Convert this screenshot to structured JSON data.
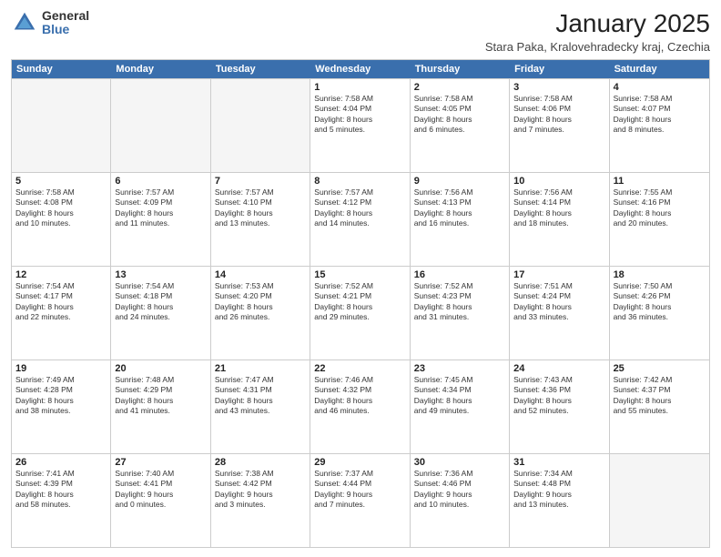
{
  "logo": {
    "general": "General",
    "blue": "Blue"
  },
  "title": "January 2025",
  "location": "Stara Paka, Kralovehradecky kraj, Czechia",
  "header": {
    "days": [
      "Sunday",
      "Monday",
      "Tuesday",
      "Wednesday",
      "Thursday",
      "Friday",
      "Saturday"
    ]
  },
  "weeks": [
    [
      {
        "day": "",
        "empty": true,
        "content": ""
      },
      {
        "day": "",
        "empty": true,
        "content": ""
      },
      {
        "day": "",
        "empty": true,
        "content": ""
      },
      {
        "day": "1",
        "content": "Sunrise: 7:58 AM\nSunset: 4:04 PM\nDaylight: 8 hours\nand 5 minutes."
      },
      {
        "day": "2",
        "content": "Sunrise: 7:58 AM\nSunset: 4:05 PM\nDaylight: 8 hours\nand 6 minutes."
      },
      {
        "day": "3",
        "content": "Sunrise: 7:58 AM\nSunset: 4:06 PM\nDaylight: 8 hours\nand 7 minutes."
      },
      {
        "day": "4",
        "content": "Sunrise: 7:58 AM\nSunset: 4:07 PM\nDaylight: 8 hours\nand 8 minutes."
      }
    ],
    [
      {
        "day": "5",
        "content": "Sunrise: 7:58 AM\nSunset: 4:08 PM\nDaylight: 8 hours\nand 10 minutes."
      },
      {
        "day": "6",
        "content": "Sunrise: 7:57 AM\nSunset: 4:09 PM\nDaylight: 8 hours\nand 11 minutes."
      },
      {
        "day": "7",
        "content": "Sunrise: 7:57 AM\nSunset: 4:10 PM\nDaylight: 8 hours\nand 13 minutes."
      },
      {
        "day": "8",
        "content": "Sunrise: 7:57 AM\nSunset: 4:12 PM\nDaylight: 8 hours\nand 14 minutes."
      },
      {
        "day": "9",
        "content": "Sunrise: 7:56 AM\nSunset: 4:13 PM\nDaylight: 8 hours\nand 16 minutes."
      },
      {
        "day": "10",
        "content": "Sunrise: 7:56 AM\nSunset: 4:14 PM\nDaylight: 8 hours\nand 18 minutes."
      },
      {
        "day": "11",
        "content": "Sunrise: 7:55 AM\nSunset: 4:16 PM\nDaylight: 8 hours\nand 20 minutes."
      }
    ],
    [
      {
        "day": "12",
        "content": "Sunrise: 7:54 AM\nSunset: 4:17 PM\nDaylight: 8 hours\nand 22 minutes."
      },
      {
        "day": "13",
        "content": "Sunrise: 7:54 AM\nSunset: 4:18 PM\nDaylight: 8 hours\nand 24 minutes."
      },
      {
        "day": "14",
        "content": "Sunrise: 7:53 AM\nSunset: 4:20 PM\nDaylight: 8 hours\nand 26 minutes."
      },
      {
        "day": "15",
        "content": "Sunrise: 7:52 AM\nSunset: 4:21 PM\nDaylight: 8 hours\nand 29 minutes."
      },
      {
        "day": "16",
        "content": "Sunrise: 7:52 AM\nSunset: 4:23 PM\nDaylight: 8 hours\nand 31 minutes."
      },
      {
        "day": "17",
        "content": "Sunrise: 7:51 AM\nSunset: 4:24 PM\nDaylight: 8 hours\nand 33 minutes."
      },
      {
        "day": "18",
        "content": "Sunrise: 7:50 AM\nSunset: 4:26 PM\nDaylight: 8 hours\nand 36 minutes."
      }
    ],
    [
      {
        "day": "19",
        "content": "Sunrise: 7:49 AM\nSunset: 4:28 PM\nDaylight: 8 hours\nand 38 minutes."
      },
      {
        "day": "20",
        "content": "Sunrise: 7:48 AM\nSunset: 4:29 PM\nDaylight: 8 hours\nand 41 minutes."
      },
      {
        "day": "21",
        "content": "Sunrise: 7:47 AM\nSunset: 4:31 PM\nDaylight: 8 hours\nand 43 minutes."
      },
      {
        "day": "22",
        "content": "Sunrise: 7:46 AM\nSunset: 4:32 PM\nDaylight: 8 hours\nand 46 minutes."
      },
      {
        "day": "23",
        "content": "Sunrise: 7:45 AM\nSunset: 4:34 PM\nDaylight: 8 hours\nand 49 minutes."
      },
      {
        "day": "24",
        "content": "Sunrise: 7:43 AM\nSunset: 4:36 PM\nDaylight: 8 hours\nand 52 minutes."
      },
      {
        "day": "25",
        "content": "Sunrise: 7:42 AM\nSunset: 4:37 PM\nDaylight: 8 hours\nand 55 minutes."
      }
    ],
    [
      {
        "day": "26",
        "content": "Sunrise: 7:41 AM\nSunset: 4:39 PM\nDaylight: 8 hours\nand 58 minutes."
      },
      {
        "day": "27",
        "content": "Sunrise: 7:40 AM\nSunset: 4:41 PM\nDaylight: 9 hours\nand 0 minutes."
      },
      {
        "day": "28",
        "content": "Sunrise: 7:38 AM\nSunset: 4:42 PM\nDaylight: 9 hours\nand 3 minutes."
      },
      {
        "day": "29",
        "content": "Sunrise: 7:37 AM\nSunset: 4:44 PM\nDaylight: 9 hours\nand 7 minutes."
      },
      {
        "day": "30",
        "content": "Sunrise: 7:36 AM\nSunset: 4:46 PM\nDaylight: 9 hours\nand 10 minutes."
      },
      {
        "day": "31",
        "content": "Sunrise: 7:34 AM\nSunset: 4:48 PM\nDaylight: 9 hours\nand 13 minutes."
      },
      {
        "day": "",
        "empty": true,
        "content": ""
      }
    ]
  ]
}
